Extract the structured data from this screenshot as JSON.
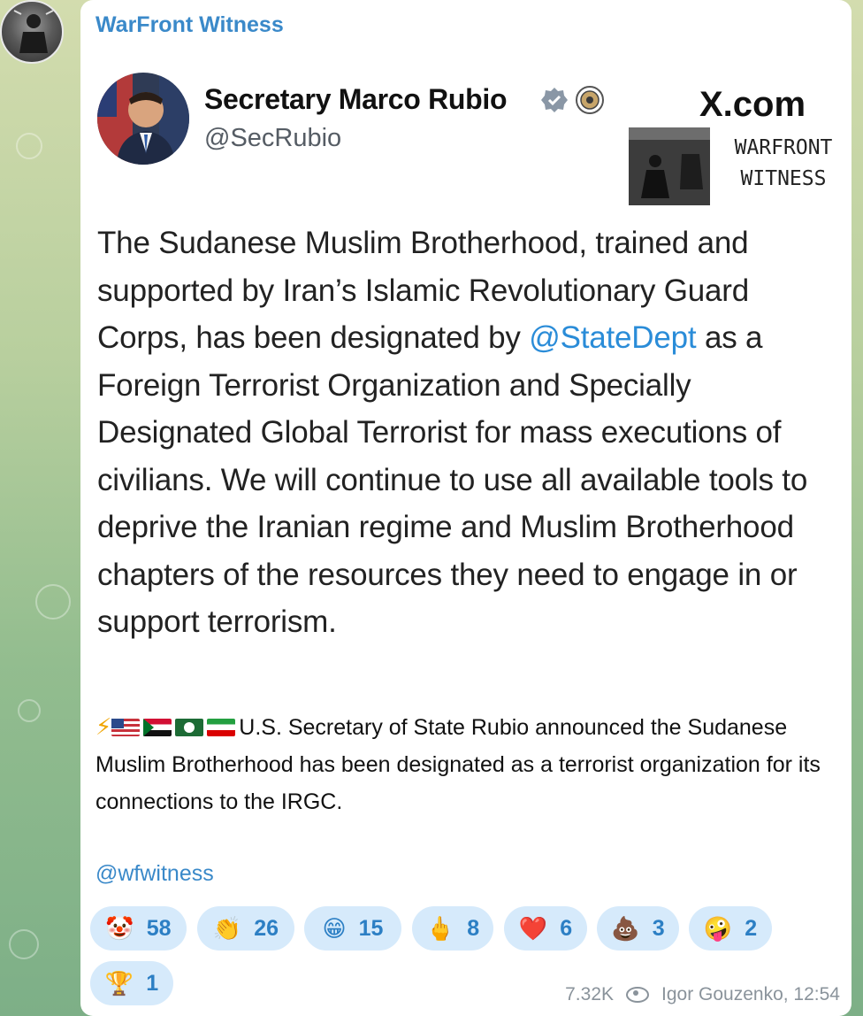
{
  "channel": {
    "name": "WarFront Witness"
  },
  "tweet": {
    "author_name": "Secretary Marco Rubio",
    "handle": "@SecRubio",
    "platform": "X.com",
    "watermark": [
      "WARFRONT",
      "WITNESS"
    ],
    "text_before_mention": "The Sudanese Muslim Brotherhood, trained and supported by Iran’s Islamic Revolutionary Guard Corps, has been designated by ",
    "mention": "@StateDept",
    "text_after_mention": " as a Foreign Terrorist Organization and Specially Designated Global Terrorist for mass executions of civilians. We will continue to use all available tools to deprive the Iranian regime and Muslim Brotherhood chapters of the resources they need to engage in or support terrorism."
  },
  "caption": {
    "emoji_prefix": "⚡",
    "text": "U.S. Secretary of State Rubio announced the Sudanese Muslim Brotherhood has been designated as a terrorist organization for its connections to the IRGC."
  },
  "footer_handle": "@wfwitness",
  "reactions": [
    {
      "emoji": "🤡",
      "count": "58"
    },
    {
      "emoji": "👏",
      "count": "26"
    },
    {
      "emoji": "😁",
      "count": "15"
    },
    {
      "emoji": "🖕",
      "count": "8"
    },
    {
      "emoji": "❤️",
      "count": "6"
    },
    {
      "emoji": "💩",
      "count": "3"
    },
    {
      "emoji": "🤪",
      "count": "2"
    },
    {
      "emoji": "🏆",
      "count": "1"
    }
  ],
  "meta": {
    "views": "7.32K",
    "author_time": "Igor Gouzenko, 12:54"
  },
  "colors": {
    "accent": "#3a89c9",
    "reaction_bg": "#d6eafb",
    "mention": "#2a8cd8"
  }
}
